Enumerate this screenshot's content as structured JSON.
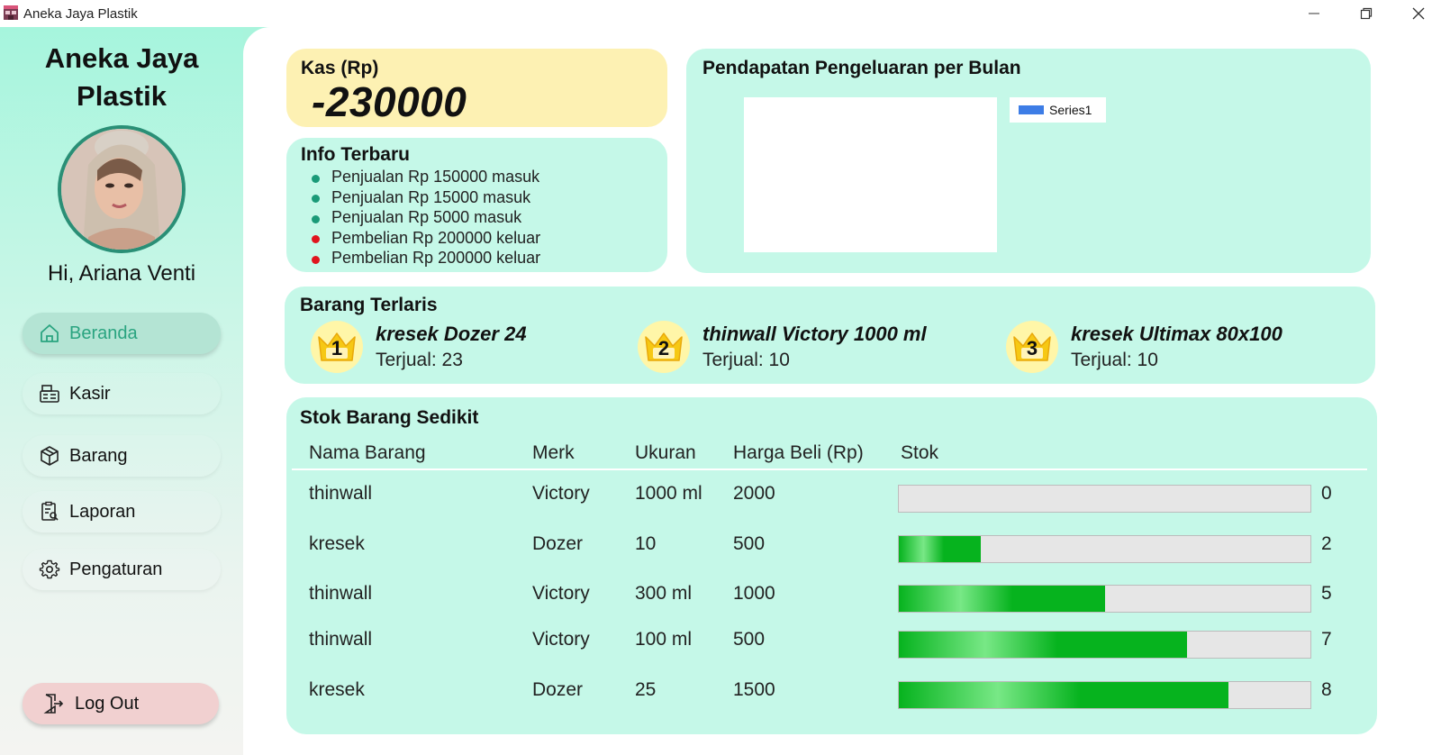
{
  "window": {
    "title": "Aneka Jaya Plastik",
    "controls": [
      "minimize",
      "restore",
      "close"
    ]
  },
  "sidebar": {
    "brand": "Aneka Jaya Plastik",
    "greeting": "Hi, Ariana Venti",
    "nav": [
      {
        "label": "Beranda",
        "icon": "home-icon",
        "active": true
      },
      {
        "label": "Kasir",
        "icon": "cashier-icon",
        "active": false
      },
      {
        "label": "Barang",
        "icon": "box-icon",
        "active": false
      },
      {
        "label": "Laporan",
        "icon": "report-icon",
        "active": false
      },
      {
        "label": "Pengaturan",
        "icon": "gear-icon",
        "active": false
      }
    ],
    "logout": "Log Out"
  },
  "kas": {
    "label": "Kas (Rp)",
    "value": "-230000"
  },
  "info": {
    "title": "Info Terbaru",
    "items": [
      {
        "text": "Penjualan Rp 150000 masuk",
        "color": "#1a9a78"
      },
      {
        "text": "Penjualan Rp 15000 masuk",
        "color": "#1a9a78"
      },
      {
        "text": "Penjualan Rp 5000 masuk",
        "color": "#1a9a78"
      },
      {
        "text": "Pembelian Rp 200000 keluar",
        "color": "#e0141e"
      },
      {
        "text": "Pembelian Rp 200000 keluar",
        "color": "#e0141e"
      }
    ]
  },
  "chart": {
    "title": "Pendapatan  Pengeluaran per Bulan",
    "legend": "Series1",
    "legend_color": "#3d7de6"
  },
  "chart_data": {
    "type": "bar",
    "title": "Pendapatan  Pengeluaran per Bulan",
    "series": [
      {
        "name": "Series1",
        "values": []
      }
    ],
    "categories": []
  },
  "best": {
    "title": "Barang Terlaris",
    "items": [
      {
        "rank": "1",
        "name": "kresek Dozer 24",
        "sold": "Terjual: 23"
      },
      {
        "rank": "2",
        "name": "thinwall Victory 1000 ml",
        "sold": "Terjual:  10"
      },
      {
        "rank": "3",
        "name": "kresek Ultimax 80x100",
        "sold": "Terjual: 10"
      }
    ]
  },
  "stock": {
    "title": "Stok Barang Sedikit",
    "columns": [
      "Nama Barang",
      "Merk",
      "Ukuran",
      "Harga Beli (Rp)",
      "Stok"
    ],
    "max_stock": 10,
    "rows": [
      {
        "nama": "thinwall",
        "merk": "Victory",
        "ukuran": "1000 ml",
        "harga": "2000",
        "stok": "0",
        "level": 0.0
      },
      {
        "nama": "kresek",
        "merk": "Dozer",
        "ukuran": " 10",
        "harga": "500",
        "stok": "2",
        "level": 0.2
      },
      {
        "nama": "thinwall",
        "merk": "Victory",
        "ukuran": "300 ml",
        "harga": "1000",
        "stok": "5",
        "level": 0.5
      },
      {
        "nama": "thinwall",
        "merk": "Victory",
        "ukuran": "100 ml",
        "harga": "500",
        "stok": "7",
        "level": 0.7
      },
      {
        "nama": "kresek",
        "merk": "Dozer",
        "ukuran": "25",
        "harga": "1500",
        "stok": "8",
        "level": 0.8
      }
    ]
  }
}
